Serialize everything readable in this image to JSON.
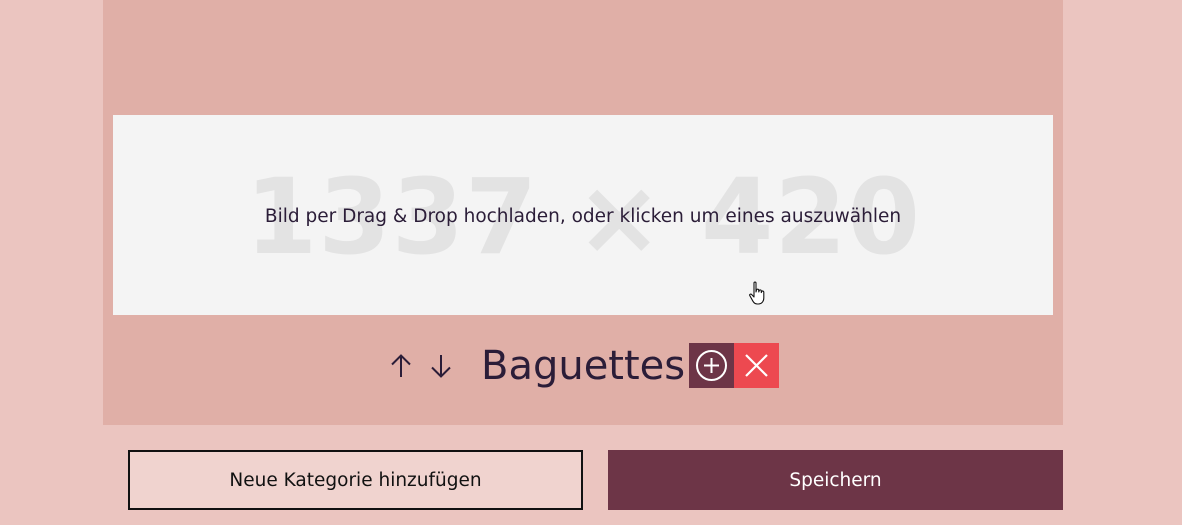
{
  "category": {
    "name": "Baguettes",
    "image": {
      "dimension_placeholder": "1337 × 420",
      "hint": "Bild per Drag & Drop hochladen, oder klicken um eines auszuwählen"
    }
  },
  "controls": {
    "move_up_icon": "arrow-up",
    "move_down_icon": "arrow-down",
    "add_icon": "plus-circle",
    "delete_icon": "x-mark"
  },
  "footer": {
    "add_category_label": "Neue Kategorie hinzufügen",
    "save_label": "Speichern"
  },
  "colors": {
    "page_background": "#ebc5c0",
    "card_background": "#e0afa7",
    "dropzone_background": "#f4f4f4",
    "accent": "#6d3547",
    "danger": "#ed4950",
    "text": "#2b1d38"
  }
}
